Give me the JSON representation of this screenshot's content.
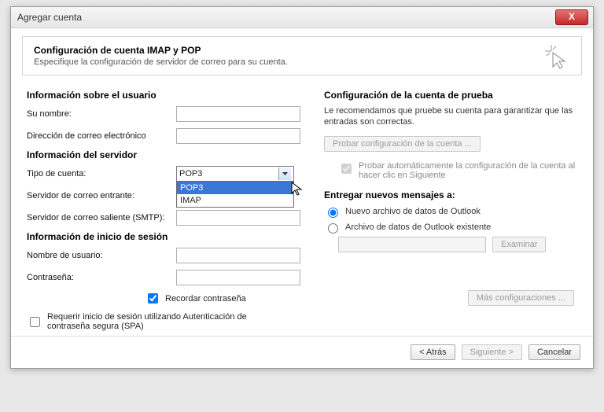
{
  "window": {
    "title": "Agregar cuenta",
    "close": "X"
  },
  "header": {
    "title": "Configuración de cuenta IMAP y POP",
    "subtitle": "Especifique la configuración de servidor de correo para su cuenta."
  },
  "left": {
    "userInfoTitle": "Información sobre el usuario",
    "yourName": "Su nombre:",
    "emailAddress": "Dirección de correo electrónico",
    "serverInfoTitle": "Información del servidor",
    "accountType": "Tipo de cuenta:",
    "accountTypeValue": "POP3",
    "accountTypeOptions": {
      "pop3": "POP3",
      "imap": "IMAP"
    },
    "incoming": "Servidor de correo entrante:",
    "outgoing": "Servidor de correo saliente (SMTP):",
    "loginInfoTitle": "Información de inicio de sesión",
    "username": "Nombre de usuario:",
    "password": "Contraseña:",
    "rememberPwd": "Recordar contraseña",
    "spa": "Requerir inicio de sesión utilizando Autenticación de contraseña segura (SPA)"
  },
  "right": {
    "testTitle": "Configuración de la cuenta de prueba",
    "testDesc": "Le recomendamos que pruebe su cuenta para garantizar que las entradas son correctas.",
    "testBtn": "Probar configuración de la cuenta ...",
    "autoTest": "Probar automáticamente la configuración de la cuenta al hacer clic en Siguiente",
    "deliverTitle": "Entregar nuevos mensajes a:",
    "radioNew": "Nuevo archivo de datos de Outlook",
    "radioExisting": "Archivo de datos de Outlook existente",
    "browse": "Examinar",
    "moreSettings": "Más configuraciones ..."
  },
  "footer": {
    "back": "< Atrás",
    "next": "Siguiente >",
    "cancel": "Cancelar"
  }
}
